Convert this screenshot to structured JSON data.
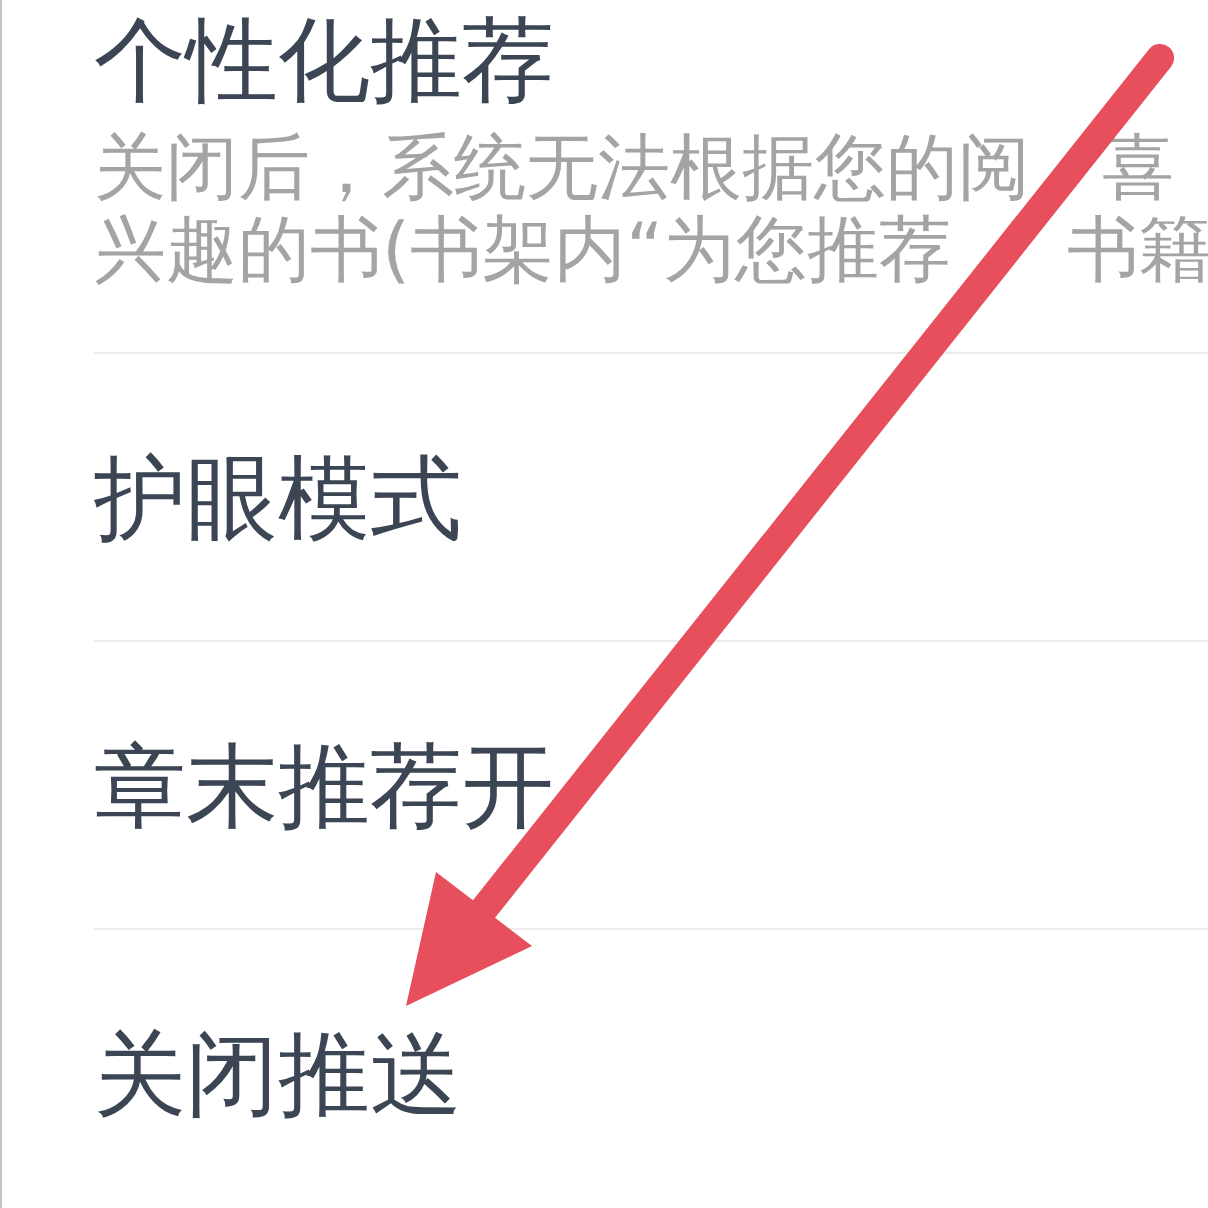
{
  "settings": [
    {
      "title": "个性化推荐",
      "description_lines": [
        [
          "关闭后，系统无法根据您的阅",
          "喜"
        ],
        [
          "兴趣的书(书架内“为您推荐",
          "书籍"
        ]
      ]
    },
    {
      "title": "护眼模式"
    },
    {
      "title": "章末推荐开"
    },
    {
      "title": "关闭推送"
    }
  ]
}
